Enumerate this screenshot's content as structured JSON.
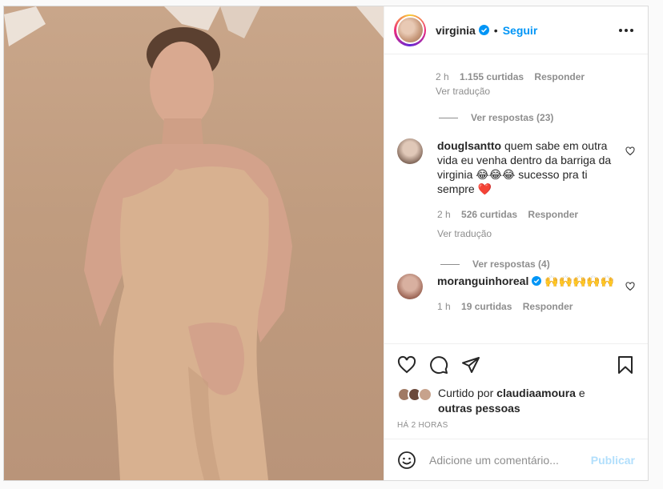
{
  "header": {
    "username": "virginia",
    "follow_label": "Seguir",
    "separator": "•"
  },
  "comments": {
    "top_partial": {
      "meta": {
        "time": "2 h",
        "likes": "1.155 curtidas",
        "reply": "Responder"
      },
      "translate": "Ver tradução",
      "replies": "Ver respostas (23)"
    },
    "items": [
      {
        "username": "douglsantto",
        "text": "quem sabe em outra vida eu venha dentro da barriga da virginia 😂😂😂 sucesso pra ti sempre ❤️",
        "meta": {
          "time": "2 h",
          "likes": "526 curtidas",
          "reply": "Responder"
        },
        "translate": "Ver tradução",
        "replies": "Ver respostas (4)"
      },
      {
        "username": "moranguinhoreal",
        "text": "🙌🙌🙌🙌🙌",
        "meta": {
          "time": "1 h",
          "likes": "19 curtidas",
          "reply": "Responder"
        }
      }
    ]
  },
  "actions": {
    "icons": [
      "heart-icon",
      "comment-icon",
      "share-icon",
      "bookmark-icon"
    ]
  },
  "likes": {
    "prefix": "Curtido por",
    "user": "claudiaamoura",
    "conj": "e",
    "others": "outras pessoas"
  },
  "timestamp": "HÁ 2 HORAS",
  "composer": {
    "placeholder": "Adicione um comentário...",
    "publish_label": "Publicar"
  },
  "colors": {
    "accent": "#0095f6",
    "publish_disabled": "#b2dffc",
    "muted": "#8e8e8e"
  }
}
